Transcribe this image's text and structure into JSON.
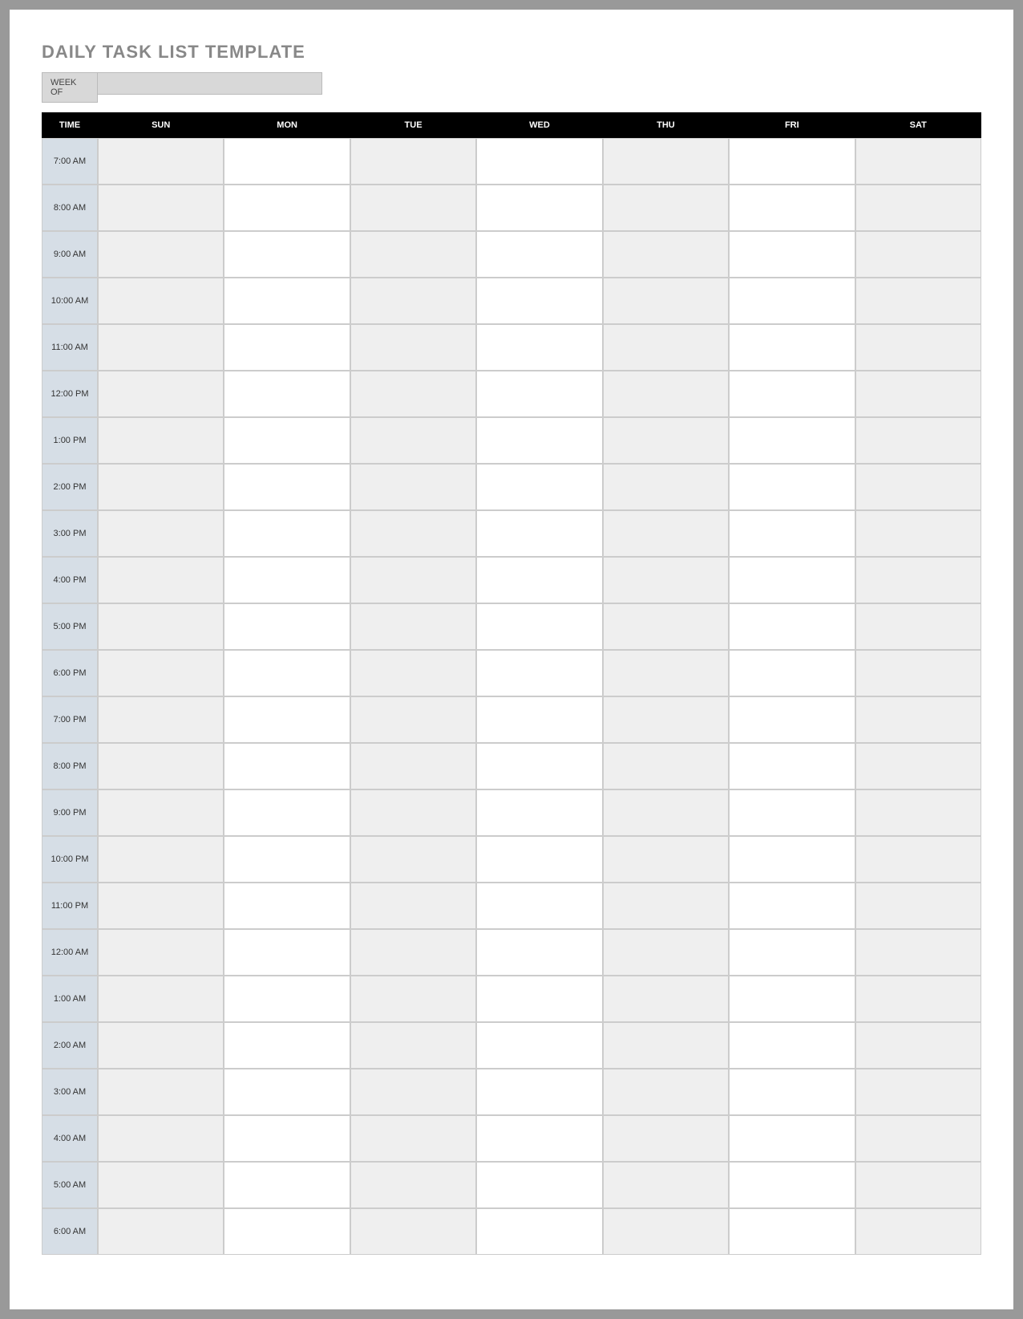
{
  "title": "DAILY TASK LIST TEMPLATE",
  "week_of_label": "WEEK OF",
  "week_of_value": "",
  "headers": {
    "time": "TIME",
    "days": [
      "SUN",
      "MON",
      "TUE",
      "WED",
      "THU",
      "FRI",
      "SAT"
    ]
  },
  "times": [
    "7:00 AM",
    "8:00 AM",
    "9:00 AM",
    "10:00 AM",
    "11:00 AM",
    "12:00 PM",
    "1:00 PM",
    "2:00 PM",
    "3:00 PM",
    "4:00 PM",
    "5:00 PM",
    "6:00 PM",
    "7:00 PM",
    "8:00 PM",
    "9:00 PM",
    "10:00 PM",
    "11:00 PM",
    "12:00 AM",
    "1:00 AM",
    "2:00 AM",
    "3:00 AM",
    "4:00 AM",
    "5:00 AM",
    "6:00 AM"
  ],
  "cells": [
    [
      "",
      "",
      "",
      "",
      "",
      "",
      ""
    ],
    [
      "",
      "",
      "",
      "",
      "",
      "",
      ""
    ],
    [
      "",
      "",
      "",
      "",
      "",
      "",
      ""
    ],
    [
      "",
      "",
      "",
      "",
      "",
      "",
      ""
    ],
    [
      "",
      "",
      "",
      "",
      "",
      "",
      ""
    ],
    [
      "",
      "",
      "",
      "",
      "",
      "",
      ""
    ],
    [
      "",
      "",
      "",
      "",
      "",
      "",
      ""
    ],
    [
      "",
      "",
      "",
      "",
      "",
      "",
      ""
    ],
    [
      "",
      "",
      "",
      "",
      "",
      "",
      ""
    ],
    [
      "",
      "",
      "",
      "",
      "",
      "",
      ""
    ],
    [
      "",
      "",
      "",
      "",
      "",
      "",
      ""
    ],
    [
      "",
      "",
      "",
      "",
      "",
      "",
      ""
    ],
    [
      "",
      "",
      "",
      "",
      "",
      "",
      ""
    ],
    [
      "",
      "",
      "",
      "",
      "",
      "",
      ""
    ],
    [
      "",
      "",
      "",
      "",
      "",
      "",
      ""
    ],
    [
      "",
      "",
      "",
      "",
      "",
      "",
      ""
    ],
    [
      "",
      "",
      "",
      "",
      "",
      "",
      ""
    ],
    [
      "",
      "",
      "",
      "",
      "",
      "",
      ""
    ],
    [
      "",
      "",
      "",
      "",
      "",
      "",
      ""
    ],
    [
      "",
      "",
      "",
      "",
      "",
      "",
      ""
    ],
    [
      "",
      "",
      "",
      "",
      "",
      "",
      ""
    ],
    [
      "",
      "",
      "",
      "",
      "",
      "",
      ""
    ],
    [
      "",
      "",
      "",
      "",
      "",
      "",
      ""
    ],
    [
      "",
      "",
      "",
      "",
      "",
      "",
      ""
    ]
  ],
  "shaded_columns": [
    0,
    2,
    4,
    6
  ]
}
